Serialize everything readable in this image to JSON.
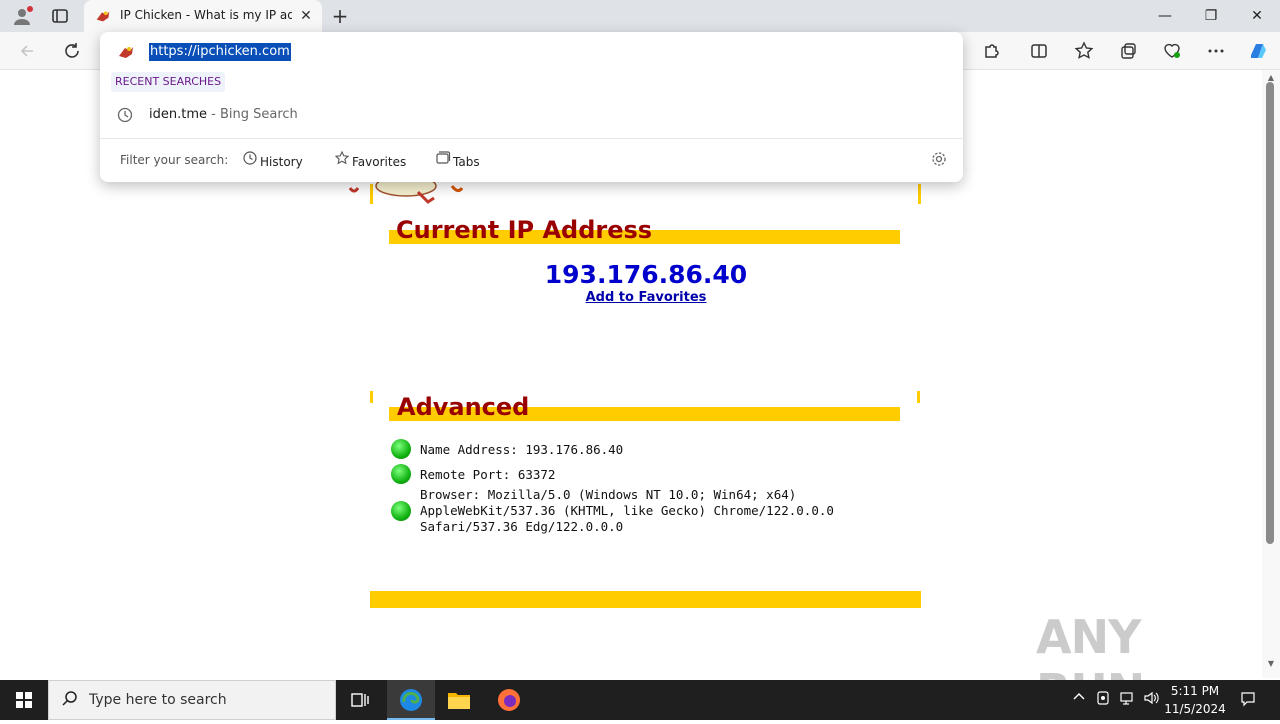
{
  "tab": {
    "title": "IP Chicken - What is my IP addre",
    "close": "✕",
    "new_tab": "+"
  },
  "window": {
    "minimize": "—",
    "maximize": "❐",
    "close": "✕"
  },
  "omnibox": {
    "url": "https://ipchicken.com",
    "recent_label": "RECENT SEARCHES",
    "recent_items": [
      {
        "query": "iden.tme",
        "source": " - Bing Search"
      }
    ],
    "filter_label": "Filter your search:",
    "filters": [
      "History",
      "Favorites",
      "Tabs"
    ]
  },
  "page": {
    "current_ip_heading": "Current IP Address",
    "ip": "193.176.86.40",
    "add_to_favorites": "Add to Favorites",
    "advanced_heading": "Advanced",
    "advanced": {
      "name_address": "Name Address: 193.176.86.40",
      "remote_port": "Remote Port: 63372",
      "browser_line1": "Browser: Mozilla/5.0 (Windows NT 10.0; Win64; x64)",
      "browser_line2": "AppleWebKit/537.36 (KHTML, like Gecko) Chrome/122.0.0.0",
      "browser_line3": "Safari/537.36 Edg/122.0.0.0"
    },
    "accent_color": "#ffcc00",
    "heading_color": "#990000",
    "ip_color": "#0000cc"
  },
  "taskbar": {
    "search_placeholder": "Type here to search",
    "time": "5:11 PM",
    "date": "11/5/2024"
  },
  "watermark": "ANY RUN"
}
